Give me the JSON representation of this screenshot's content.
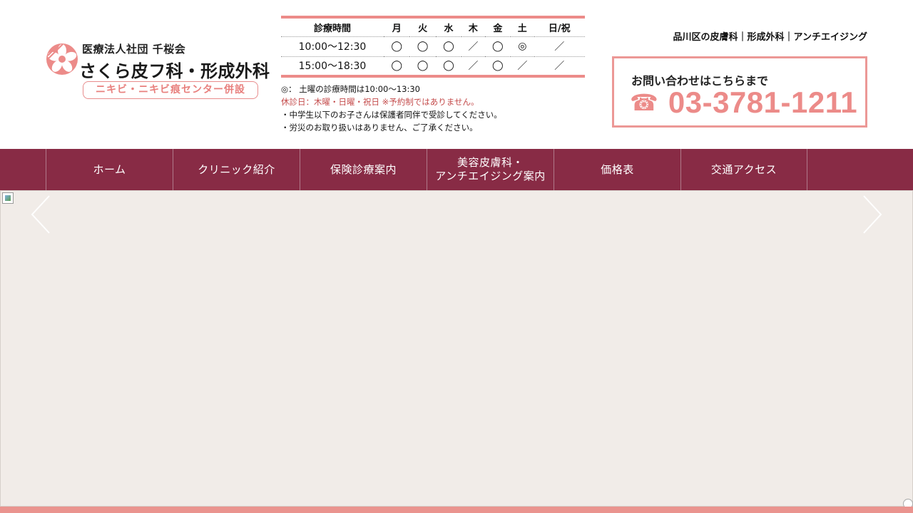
{
  "logo": {
    "organization": "医療法人社団 千桜会",
    "name": "さくら皮フ科・形成外科",
    "subtitle": "ニキビ・ニキビ痕センター併設",
    "mark_icon": "sakura-flower-icon",
    "accent_color": "#ec8b89"
  },
  "hours": {
    "header_label": "診療時間",
    "days": [
      "月",
      "火",
      "水",
      "木",
      "金",
      "土",
      "日/祝"
    ],
    "rows": [
      {
        "time": "10:00～12:30",
        "marks": [
          "◯",
          "◯",
          "◯",
          "／",
          "◯",
          "◎",
          "／"
        ]
      },
      {
        "time": "15:00～18:30",
        "marks": [
          "◯",
          "◯",
          "◯",
          "／",
          "◯",
          "／",
          "／"
        ]
      }
    ]
  },
  "notes": {
    "saturday": "◎： 土曜の診療時間は10:00～13:30",
    "closed": "休診日：木曜・日曜・祝日 ※予約制ではありません。",
    "guardian": "・中学生以下のお子さんは保護者同伴で受診してください。",
    "workers_comp": "・労災のお取り扱いはありません、ご了承ください。"
  },
  "tagline": "品川区の皮膚科｜形成外科｜アンチエイジング",
  "contact": {
    "label": "お問い合わせはこちらまで",
    "phone_icon": "☎",
    "phone": "03-3781-1211",
    "border_color": "#ec9896"
  },
  "nav": {
    "background_color": "#882b45",
    "items": [
      {
        "line1": "ホーム",
        "line2": ""
      },
      {
        "line1": "クリニック紹介",
        "line2": ""
      },
      {
        "line1": "保険診療案内",
        "line2": ""
      },
      {
        "line1": "美容皮膚科・",
        "line2": "アンチエイジング案内"
      },
      {
        "line1": "価格表",
        "line2": ""
      },
      {
        "line1": "交通アクセス",
        "line2": ""
      }
    ]
  },
  "hero": {
    "background_color": "#f1ece8",
    "prev_icon": "chevron-left-icon",
    "next_icon": "chevron-right-icon"
  }
}
